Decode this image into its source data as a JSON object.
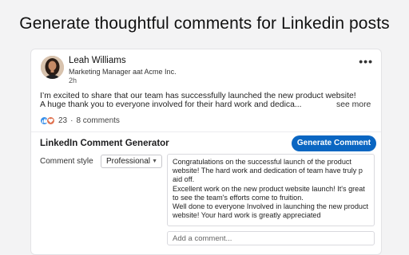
{
  "headline": "Generate thoughtful comments for Linkedin posts",
  "post": {
    "author_name": "Leah Williams",
    "author_title": "Marketing Manager aat Acme Inc.",
    "time": "2h",
    "more_icon": "more-horizontal-icon",
    "text_line1": "I’m excited to  share that our team has successfully launched the new product website!",
    "text_line2": "A huge thank you to everyone involved for their hard work and dedica...",
    "see_more": "see more",
    "reaction_count": "23",
    "separator": "·",
    "comments_count": "8 comments",
    "reaction_icons": [
      "like-icon",
      "heart-icon"
    ]
  },
  "generator": {
    "title": "LinkedIn Comment Generator",
    "button_label": "Generate Comment",
    "style_label": "Comment style",
    "style_value": "Professional",
    "suggestions": [
      "Congratulations on the successful launch of the product website! The hard work and dedication of team have truly p aid off.",
      "Excellent work on the new product website launch! It's great to see the team's efforts come to fruition.",
      "Well done to everyone Involved in launching the new product website! Your hard work is greatly appreciated"
    ],
    "comment_placeholder": "Add a comment..."
  },
  "colors": {
    "accent": "#0a66c2",
    "like": "#378fe9",
    "heart": "#df704d",
    "page_bg": "#f3f3f4"
  }
}
